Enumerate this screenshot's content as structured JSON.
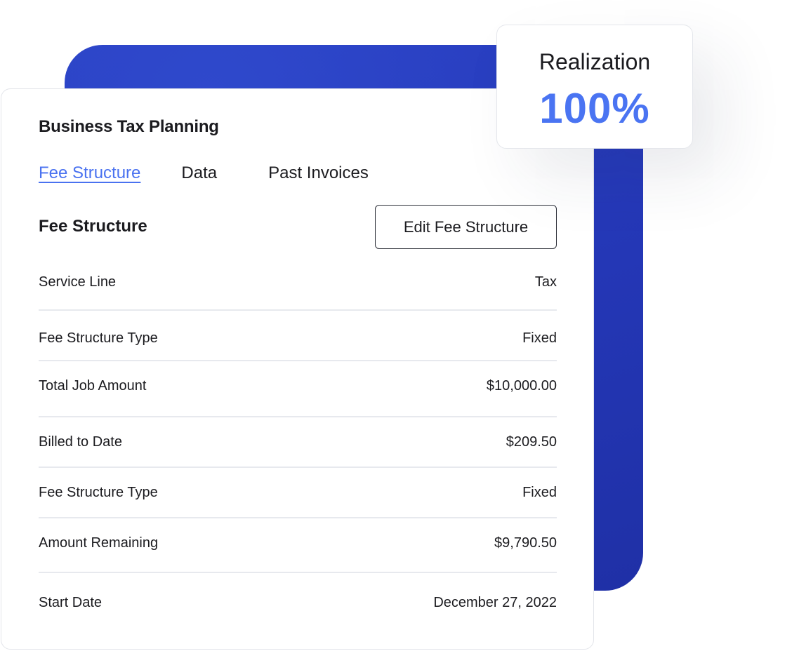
{
  "card": {
    "title": "Business Tax Planning",
    "tabs": [
      {
        "label": "Fee Structure",
        "active": true
      },
      {
        "label": "Data",
        "active": false
      },
      {
        "label": "Past Invoices",
        "active": false
      }
    ],
    "section_title": "Fee Structure",
    "edit_button_label": "Edit Fee Structure",
    "rows": [
      {
        "label": "Service Line",
        "value": "Tax"
      },
      {
        "label": "Fee Structure Type",
        "value": "Fixed"
      },
      {
        "label": "Total Job Amount",
        "value": "$10,000.00"
      },
      {
        "label": "Billed to Date",
        "value": "$209.50"
      },
      {
        "label": "Fee Structure Type",
        "value": "Fixed"
      },
      {
        "label": "Amount Remaining",
        "value": "$9,790.50"
      },
      {
        "label": "Start Date",
        "value": "December 27, 2022"
      }
    ]
  },
  "realization": {
    "label": "Realization",
    "value": "100%"
  },
  "colors": {
    "accent": "#4a72f0",
    "backdrop": "#2437b6",
    "text": "#1b1b1f"
  }
}
